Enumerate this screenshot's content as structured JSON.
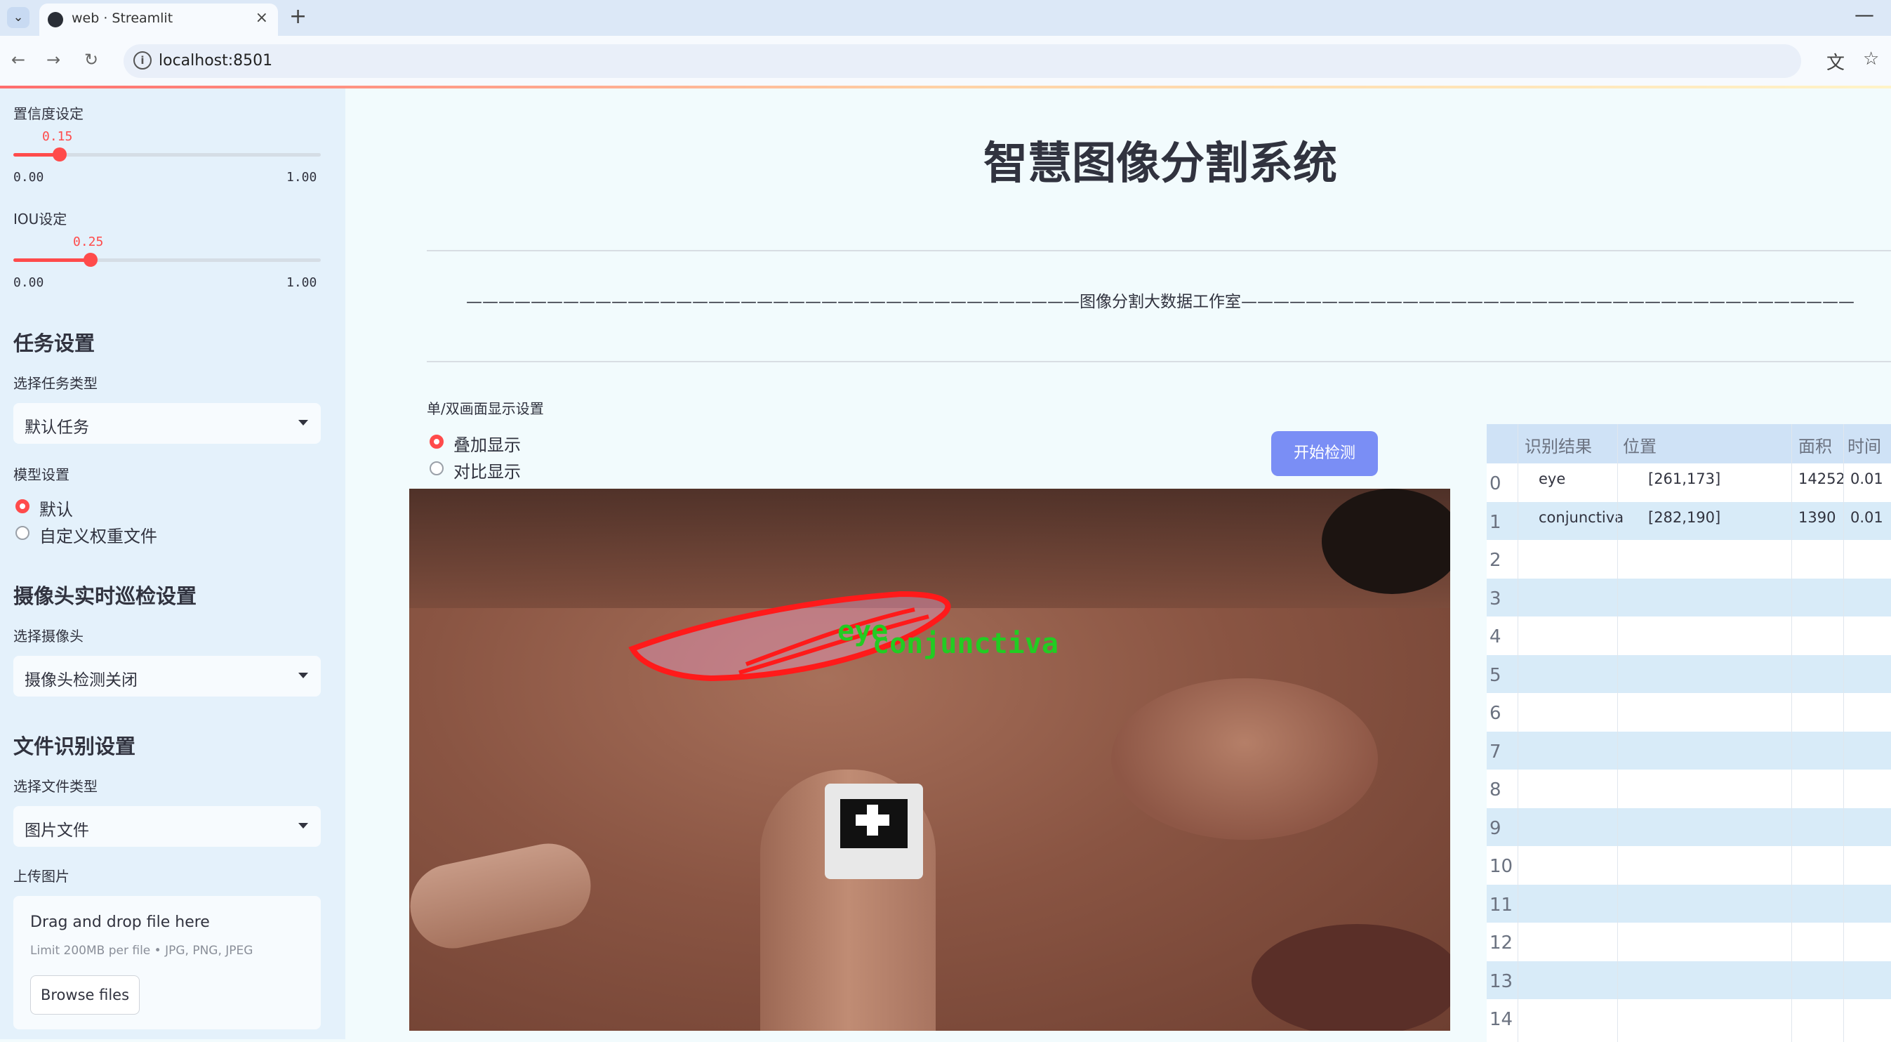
{
  "browser": {
    "tab_title": "web · Streamlit",
    "tab_close": "×",
    "new_tab": "+",
    "minimize": "—",
    "url": "localhost:8501",
    "back": "←",
    "forward": "→",
    "reload": "↻",
    "info": "i",
    "translate_icon": "⽂",
    "bookmark_icon": "☆"
  },
  "sidebar": {
    "conf": {
      "label": "置信度设定",
      "value": "0.15",
      "value_num": 0.15,
      "min": "0.00",
      "max": "1.00"
    },
    "iou": {
      "label": "IOU设定",
      "value": "0.25",
      "value_num": 0.25,
      "min": "0.00",
      "max": "1.00"
    },
    "task": {
      "heading": "任务设置",
      "label": "选择任务类型",
      "selected": "默认任务"
    },
    "model": {
      "label": "模型设置",
      "options": [
        "默认",
        "自定义权重文件"
      ],
      "selected_index": 0
    },
    "camera": {
      "heading": "摄像头实时巡检设置",
      "label": "选择摄像头",
      "selected": "摄像头检测关闭"
    },
    "file": {
      "heading": "文件识别设置",
      "label": "选择文件类型",
      "selected": "图片文件"
    },
    "upload": {
      "label": "上传图片",
      "title": "Drag and drop file here",
      "limit": "Limit 200MB per file • JPG, PNG, JPEG",
      "button": "Browse files"
    }
  },
  "main": {
    "title": "智慧图像分割系统",
    "subtitle": "——————————————————————————————————————图像分割大数据工作室——————————————————————————————————————",
    "display_mode": {
      "label": "单/双画面显示设置",
      "options": [
        "叠加显示",
        "对比显示"
      ],
      "selected_index": 0
    },
    "start_button": "开始检测",
    "overlay_labels": [
      "eye",
      "conjunctiva"
    ],
    "overlay_colors": {
      "eye_contour": "#ff1a1a",
      "label_text": "#22cc22"
    }
  },
  "table": {
    "headers": [
      "识别结果",
      "位置",
      "面积",
      "时间"
    ],
    "rows": [
      {
        "idx": "0",
        "result": "eye",
        "pos": "[261,173]",
        "area": "14252",
        "time": "0.01"
      },
      {
        "idx": "1",
        "result": "conjunctiva",
        "pos": "[282,190]",
        "area": "1390",
        "time": "0.01"
      },
      {
        "idx": "2"
      },
      {
        "idx": "3"
      },
      {
        "idx": "4"
      },
      {
        "idx": "5"
      },
      {
        "idx": "6"
      },
      {
        "idx": "7"
      },
      {
        "idx": "8"
      },
      {
        "idx": "9"
      },
      {
        "idx": "10"
      },
      {
        "idx": "11"
      },
      {
        "idx": "12"
      },
      {
        "idx": "13"
      },
      {
        "idx": "14"
      }
    ]
  },
  "colors": {
    "accent": "#ff4b4b",
    "button": "#7a8ef5",
    "sidebar_bg": "#e4f1fb",
    "table_head": "#cfe2f6"
  }
}
